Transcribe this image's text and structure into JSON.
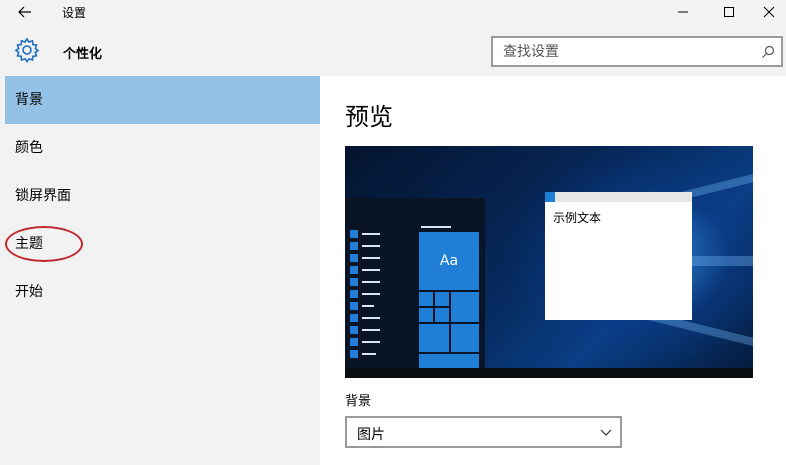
{
  "window": {
    "title": "设置"
  },
  "header": {
    "title": "个性化",
    "search_placeholder": "查找设置"
  },
  "sidebar": {
    "items": [
      {
        "label": "背景",
        "selected": true
      },
      {
        "label": "颜色",
        "selected": false
      },
      {
        "label": "锁屏界面",
        "selected": false
      },
      {
        "label": "主题",
        "selected": false,
        "annotated": true
      },
      {
        "label": "开始",
        "selected": false
      }
    ]
  },
  "main": {
    "preview_title": "预览",
    "preview": {
      "tile_label": "Aa",
      "sample_window_text": "示例文本"
    },
    "background_label": "背景",
    "background_value": "图片"
  },
  "colors": {
    "accent": "#1f7fd6",
    "selected_item": "#94c2e6",
    "annotation": "#c0282e"
  }
}
